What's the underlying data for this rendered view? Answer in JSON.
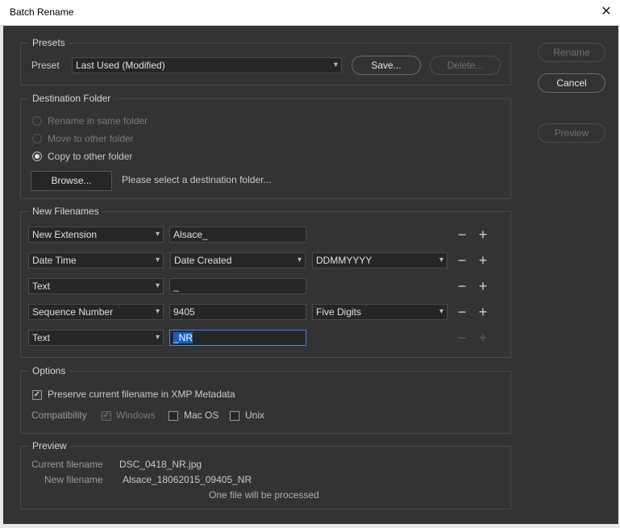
{
  "window": {
    "title": "Batch Rename",
    "close_icon": "close-icon"
  },
  "actions": {
    "rename": "Rename",
    "cancel": "Cancel",
    "preview": "Preview"
  },
  "presets": {
    "legend": "Presets",
    "label": "Preset",
    "value": "Last Used (Modified)",
    "save": "Save...",
    "delete": "Delete..."
  },
  "destination": {
    "legend": "Destination Folder",
    "options": [
      {
        "label": "Rename in same folder",
        "selected": false,
        "enabled": false
      },
      {
        "label": "Move to other folder",
        "selected": false,
        "enabled": false
      },
      {
        "label": "Copy to other folder",
        "selected": true,
        "enabled": true
      }
    ],
    "browse": "Browse...",
    "hint": "Please select a destination folder..."
  },
  "filenames": {
    "legend": "New Filenames",
    "rows": [
      {
        "type": "New Extension",
        "value": "Alsace_",
        "third": ""
      },
      {
        "type": "Date Time",
        "value": "Date Created",
        "third": "DDMMYYYY"
      },
      {
        "type": "Text",
        "value": "_",
        "third": ""
      },
      {
        "type": "Sequence Number",
        "value": "9405",
        "third": "Five Digits"
      },
      {
        "type": "Text",
        "value": "_NR",
        "third": ""
      }
    ]
  },
  "options": {
    "legend": "Options",
    "preserve": "Preserve current filename in XMP Metadata",
    "compat_label": "Compatibility",
    "windows": "Windows",
    "macos": "Mac OS",
    "unix": "Unix"
  },
  "preview": {
    "legend": "Preview",
    "current_label": "Current filename",
    "current_value": "DSC_0418_NR.jpg",
    "new_label": "New filename",
    "new_value": "Alsace_18062015_09405_NR",
    "summary": "One file will be processed"
  }
}
